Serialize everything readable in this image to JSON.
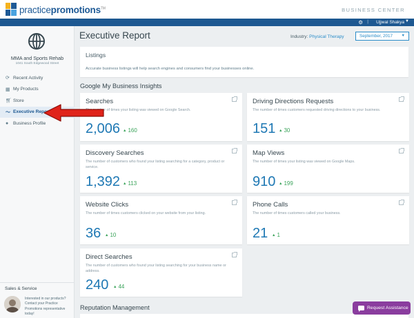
{
  "header": {
    "brand_light": "practice",
    "brand_bold": "promotions",
    "brand_tm": "TM",
    "app_label": "BUSINESS CENTER",
    "user_name": "Ujjwal Shakya",
    "separator": "|"
  },
  "sidebar": {
    "business_name": "MMA and Sports Rehab",
    "business_address": "1041 South Edgewood Street",
    "items": [
      {
        "label": "Recent Activity",
        "icon": "refresh-icon",
        "active": false
      },
      {
        "label": "My Products",
        "icon": "grid-icon",
        "active": false
      },
      {
        "label": "Store",
        "icon": "cart-icon",
        "active": false
      },
      {
        "label": "Executive Report",
        "icon": "trend-icon",
        "active": true
      },
      {
        "label": "Business Profile",
        "icon": "pin-icon",
        "active": false
      }
    ],
    "sales_title": "Sales & Service",
    "sales_text": "Interested in our products? Contact your Practice Promotions representative today!"
  },
  "main": {
    "title": "Executive Report",
    "industry_label": "Industry:",
    "industry_value": "Physical Therapy",
    "month": "September, 2017",
    "listings_title": "Listings",
    "listings_desc": "Accurate business listings will help search engines and consumers find your businesses online.",
    "gmb_title": "Google My Business Insights",
    "reputation_title": "Reputation Management"
  },
  "cards": [
    {
      "title": "Searches",
      "desc": "The number of times your listing was viewed on Google Search.",
      "value": "2,006",
      "delta": "160"
    },
    {
      "title": "Driving Directions Requests",
      "desc": "The number of times customers requested driving directions to your business.",
      "value": "151",
      "delta": "30"
    },
    {
      "title": "Discovery Searches",
      "desc": "The number of customers who found your listing searching for a category, product or service.",
      "value": "1,392",
      "delta": "113"
    },
    {
      "title": "Map Views",
      "desc": "The number of times your listing was viewed on Google Maps.",
      "value": "910",
      "delta": "199"
    },
    {
      "title": "Website Clicks",
      "desc": "The number of times customers clicked on your website from your listing.",
      "value": "36",
      "delta": "10"
    },
    {
      "title": "Phone Calls",
      "desc": "The number of times customers called your business.",
      "value": "21",
      "delta": "1"
    },
    {
      "title": "Direct Searches",
      "desc": "The number of customers who found your listing searching for your business name or address.",
      "value": "240",
      "delta": "44"
    }
  ],
  "assist_label": "Request Assistance",
  "colors": {
    "brand_blue": "#1d5891",
    "accent_blue": "#2a8cc8",
    "value_blue": "#1e78b4",
    "delta_green": "#3aa35a",
    "assist_purple": "#8a3d9e",
    "arrow_red": "#e0231a"
  }
}
